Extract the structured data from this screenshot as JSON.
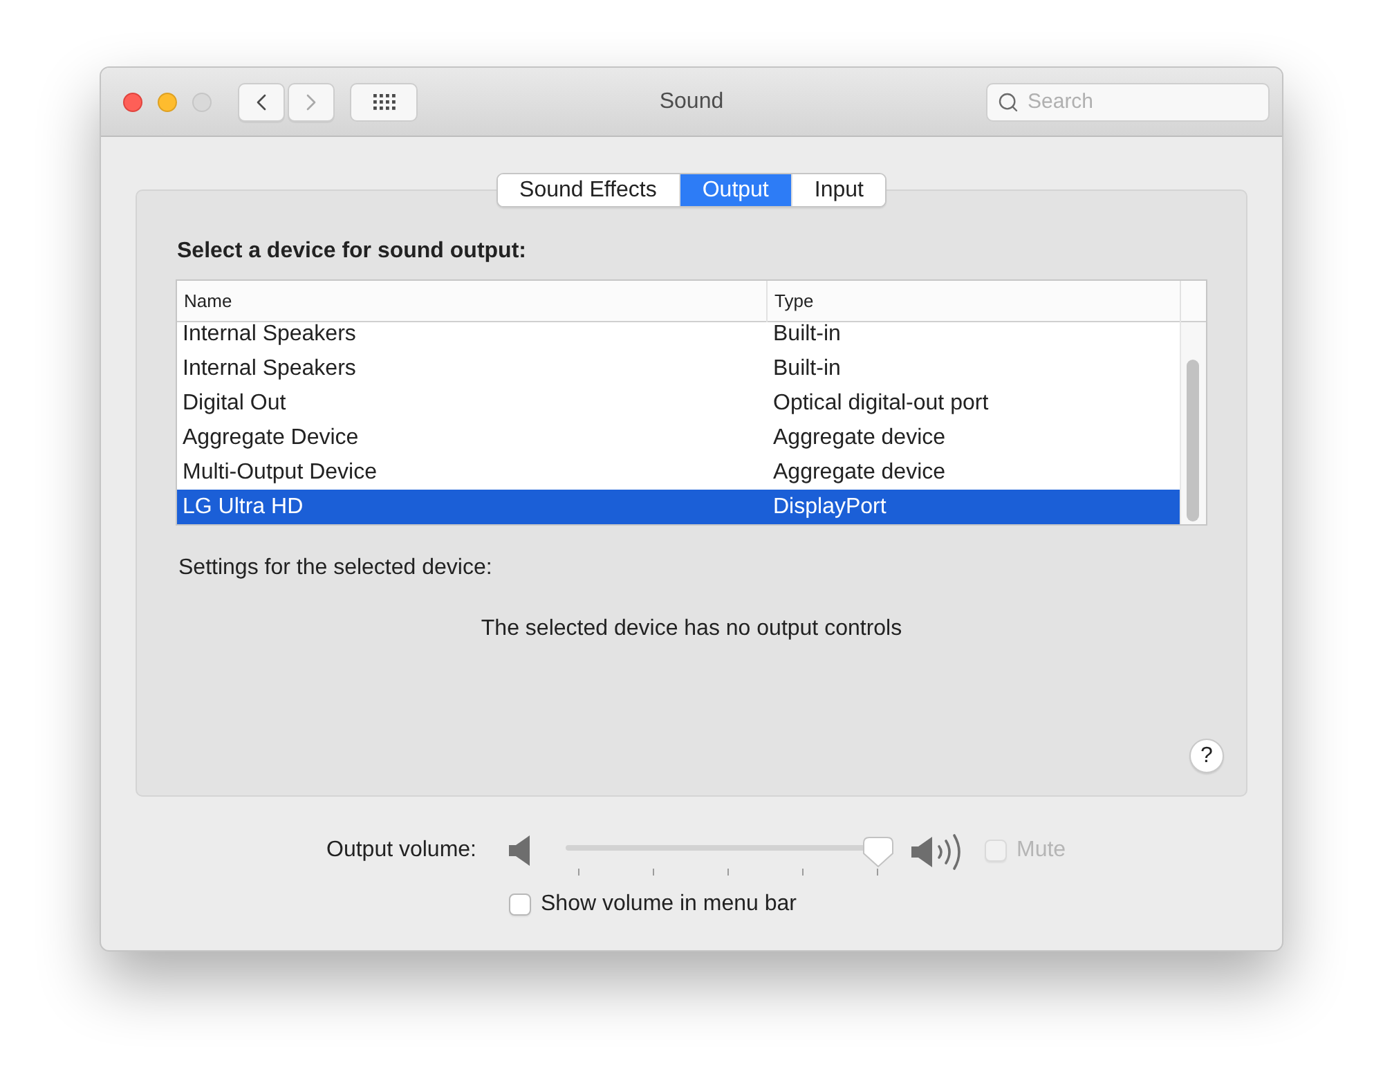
{
  "window": {
    "title": "Sound",
    "buttons": [
      {
        "kind": "close",
        "disabled": false
      },
      {
        "kind": "minimize",
        "disabled": false
      },
      {
        "kind": "zoom",
        "disabled": true
      }
    ]
  },
  "toolbar": {
    "nav_buttons": [
      {
        "kind": "back",
        "disabled": false
      },
      {
        "kind": "forward",
        "disabled": true
      }
    ]
  },
  "search": {
    "placeholder": "Search"
  },
  "tabs": [
    {
      "label": "Sound Effects",
      "selected": false
    },
    {
      "label": "Output",
      "selected": true
    },
    {
      "label": "Input",
      "selected": false
    }
  ],
  "output_panel": {
    "heading": "Select a device for sound output:",
    "table": {
      "columns": [
        "Name",
        "Type"
      ],
      "rows": [
        {
          "name": "Internal Speakers",
          "type": "Built-in",
          "selected": false
        },
        {
          "name": "Internal Speakers",
          "type": "Built-in",
          "selected": false
        },
        {
          "name": "Digital Out",
          "type": "Optical digital-out port",
          "selected": false
        },
        {
          "name": "Aggregate Device",
          "type": "Aggregate device",
          "selected": false
        },
        {
          "name": "Multi-Output Device",
          "type": "Aggregate device",
          "selected": false
        },
        {
          "name": "LG Ultra HD",
          "type": "DisplayPort",
          "selected": true
        }
      ]
    },
    "settings_label": "Settings for the selected device:",
    "message": "The selected device has no output controls",
    "help_button": "?"
  },
  "volume": {
    "label": "Output volume:",
    "level": 1,
    "mute": {
      "label": "Mute",
      "checked": false,
      "disabled": true
    }
  },
  "menu_bar_option": {
    "label": "Show volume in menu bar",
    "checked": false
  }
}
